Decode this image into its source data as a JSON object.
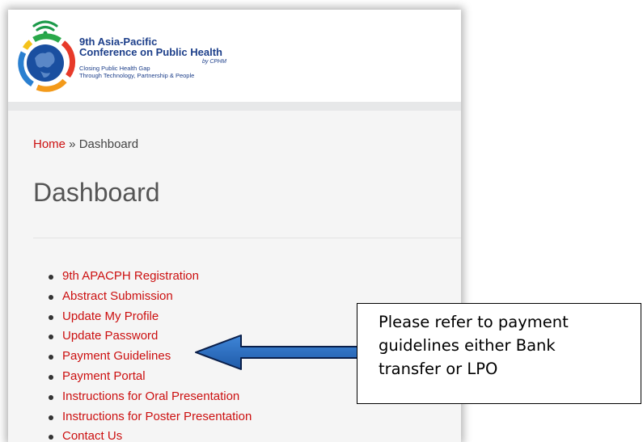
{
  "header": {
    "logo_title_line1": "9th Asia-Pacific",
    "logo_title_line2": "Conference on Public Health",
    "logo_by": "by CPHM",
    "logo_tagline_line1": "Closing Public Health Gap",
    "logo_tagline_line2": "Through Technology, Partnership & People"
  },
  "breadcrumb": {
    "home_label": "Home",
    "separator": " » ",
    "current": "Dashboard"
  },
  "page_title": "Dashboard",
  "menu": {
    "items": [
      {
        "label": "9th APACPH Registration"
      },
      {
        "label": "Abstract Submission"
      },
      {
        "label": "Update My Profile"
      },
      {
        "label": "Update Password"
      },
      {
        "label": "Payment Guidelines"
      },
      {
        "label": "Payment Portal"
      },
      {
        "label": "Instructions for Oral Presentation"
      },
      {
        "label": "Instructions for Poster Presentation"
      },
      {
        "label": "Contact Us"
      }
    ]
  },
  "callout": {
    "line1": "Please refer to payment",
    "line2": "guidelines either Bank",
    "line3": "transfer or LPO"
  },
  "colors": {
    "link": "#cc1010",
    "logo_text": "#1d3f8a",
    "arrow": "#2e6fc2",
    "content_bg": "#f5f5f5"
  },
  "icons": {
    "logo": "globe-logo-icon",
    "signal": "wifi-signal-icon",
    "arrow": "left-arrow-icon"
  }
}
